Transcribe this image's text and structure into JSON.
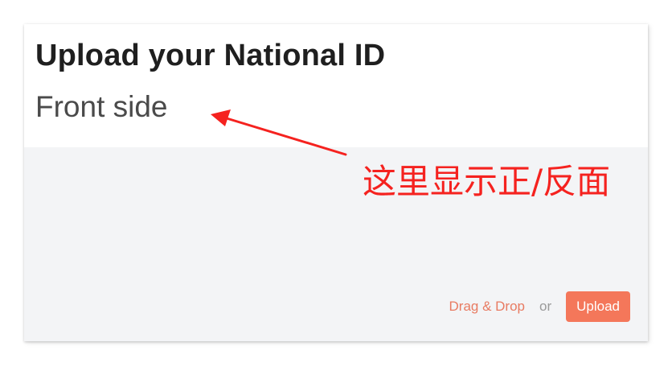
{
  "card": {
    "title": "Upload your National ID",
    "subtitle": "Front side"
  },
  "dropzone": {
    "drag_label": "Drag & Drop",
    "or_label": "or",
    "upload_label": "Upload"
  },
  "annotation": {
    "text": "这里显示正/反面",
    "color": "#f5221f"
  },
  "colors": {
    "accent": "#f4775a",
    "drag_text": "#e87b62",
    "dropzone_bg": "#f3f4f6",
    "title_text": "#1f1f1f"
  }
}
